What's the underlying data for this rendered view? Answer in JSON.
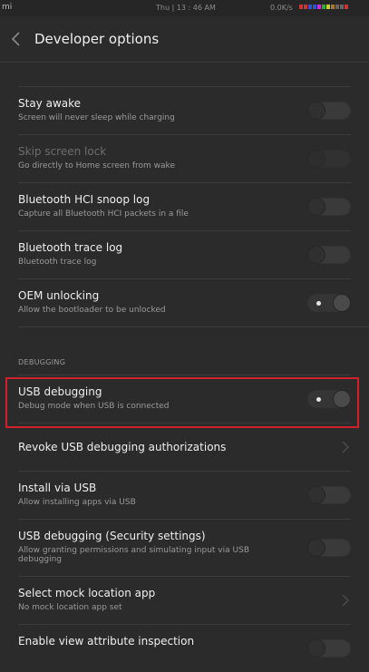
{
  "status_bar": {
    "carrier": "mi",
    "time": "Thu | 13 : 46 AM",
    "network_speed": "0.0K/s",
    "indicator_colors": [
      "#cc3333",
      "#cc3333",
      "#3355cc",
      "#3355cc",
      "#cc33cc",
      "#33aa33",
      "#cccc33",
      "#aa7733",
      "#666666",
      "#666666",
      "#cc3333"
    ]
  },
  "app_bar": {
    "title": "Developer options",
    "back_icon": "arrow-left-icon"
  },
  "items": [
    {
      "title": "Stay awake",
      "summary": "Screen will never sleep while charging",
      "control": "toggle",
      "on": false,
      "enabled": true
    },
    {
      "title": "Skip screen lock",
      "summary": "Go directly to Home screen from wake",
      "control": "toggle",
      "on": false,
      "enabled": false
    },
    {
      "title": "Bluetooth HCI snoop log",
      "summary": "Capture all Bluetooth HCI packets in a file",
      "control": "toggle",
      "on": false,
      "enabled": true
    },
    {
      "title": "Bluetooth trace log",
      "summary": "Bluetooth trace log",
      "control": "toggle",
      "on": false,
      "enabled": true
    },
    {
      "title": "OEM unlocking",
      "summary": "Allow the bootloader to be unlocked",
      "control": "toggle",
      "on": true,
      "enabled": true
    }
  ],
  "debugging_section": {
    "header": "DEBUGGING",
    "items": [
      {
        "title": "USB debugging",
        "summary": "Debug mode when USB is connected",
        "control": "toggle",
        "on": true,
        "highlighted": true
      },
      {
        "title": "Revoke USB debugging authorizations",
        "summary": "",
        "control": "chevron"
      },
      {
        "title": "Install via USB",
        "summary": "Allow installing apps via USB",
        "control": "toggle",
        "on": false
      },
      {
        "title": "USB debugging (Security settings)",
        "summary": "Allow granting permissions and simulating input via USB debugging",
        "control": "toggle",
        "on": false
      },
      {
        "title": "Select mock location app",
        "summary": "No mock location app set",
        "control": "chevron"
      },
      {
        "title": "Enable view attribute inspection",
        "summary": "",
        "control": "toggle",
        "on": false
      }
    ]
  },
  "colors": {
    "background": "#2b2b2b",
    "highlight_border": "#d0202a"
  }
}
